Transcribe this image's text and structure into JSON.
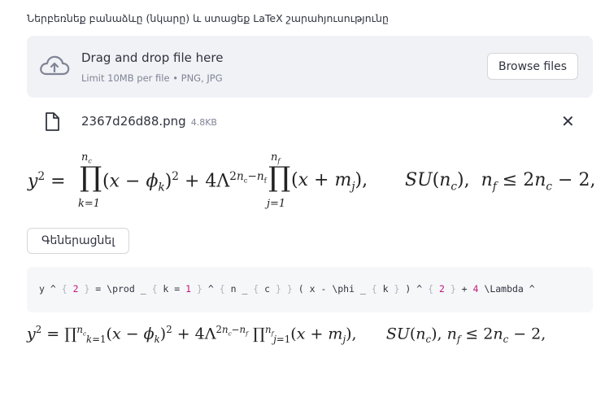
{
  "prompt_label": "Ներբեռնեք բանաձևը (նկարը) և ստացեք LaTeX շարահյուսությունը",
  "uploader": {
    "title": "Drag and drop file here",
    "subtitle": "Limit 10MB per file • PNG, JPG",
    "browse_label": "Browse files"
  },
  "file": {
    "name": "2367d26d88.png",
    "size": "4.8KB",
    "remove_symbol": "✕"
  },
  "generate_label": "Գեներացնել",
  "latex_code": "y ^ { 2 } = \\prod _ { k = 1 } ^ { n _ { c } } ( x - \\phi _ { k } ) ^ { 2 } + 4 \\Lambda ^",
  "colors": {
    "dropzone_bg": "#f0f2f6",
    "code_bg": "#f6f7f9",
    "accent_number": "#c4167d"
  },
  "icons": {
    "upload": "cloud-upload-icon",
    "file": "file-icon",
    "remove": "close-icon"
  }
}
